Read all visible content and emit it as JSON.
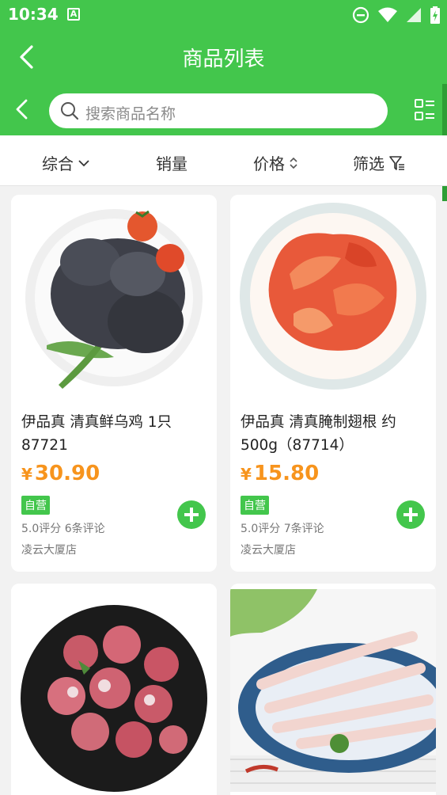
{
  "status": {
    "time": "10:34",
    "notif_icon": "A"
  },
  "titlebar": {
    "title": "商品列表",
    "back_icon": "chevron-left-icon"
  },
  "search": {
    "placeholder": "搜索商品名称"
  },
  "filters": [
    {
      "label": "综合",
      "icon": "chevron-down-icon"
    },
    {
      "label": "销量"
    },
    {
      "label": "价格",
      "icon": "sort-icon"
    },
    {
      "label": "筛选",
      "icon": "filter-icon"
    }
  ],
  "products": [
    {
      "name": "伊品真 清真鲜乌鸡 1只 87721",
      "currency": "¥",
      "price": "30.90",
      "tag": "自营",
      "rating": "5.0评分 6条评论",
      "store": "凌云大厦店"
    },
    {
      "name": "伊品真 清真腌制翅根 约500g（87714）",
      "currency": "¥",
      "price": "15.80",
      "tag": "自营",
      "rating": "5.0评分 7条评论",
      "store": "凌云大厦店"
    },
    {},
    {}
  ],
  "colors": {
    "brand_green": "#43c64c",
    "price_orange": "#f7941d"
  }
}
